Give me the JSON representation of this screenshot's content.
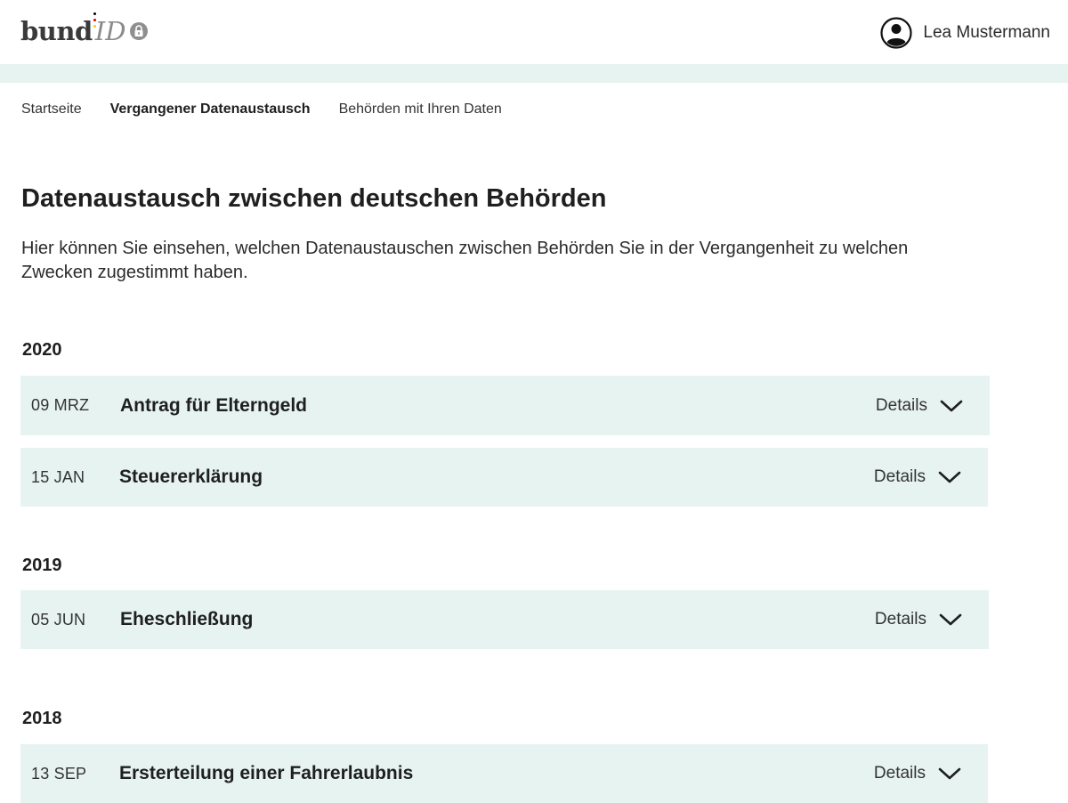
{
  "header": {
    "logo_bund": "bund",
    "logo_id": "ID",
    "user_name": "Lea Mustermann"
  },
  "nav": {
    "items": [
      {
        "label": "Startseite",
        "active": false
      },
      {
        "label": "Vergangener Datenaustausch",
        "active": true
      },
      {
        "label": "Behörden mit Ihren Daten",
        "active": false
      }
    ]
  },
  "main": {
    "title": "Datenaustausch zwischen deutschen Behörden",
    "intro": "Hier können Sie einsehen, welchen Datenaustauschen zwischen Behörden Sie in der Vergangenheit zu welchen Zwecken zugestimmt haben."
  },
  "years": [
    {
      "year": "2020",
      "entries": [
        {
          "date": "09 MRZ",
          "title": "Antrag für Elterngeld",
          "details_label": "Details"
        },
        {
          "date": "15 JAN",
          "title": "Steuererklärung",
          "details_label": "Details"
        }
      ]
    },
    {
      "year": "2019",
      "entries": [
        {
          "date": "05 JUN",
          "title": "Eheschließung",
          "details_label": "Details"
        }
      ]
    },
    {
      "year": "2018",
      "entries": [
        {
          "date": "13 SEP",
          "title": "Ersterteilung einer Fahrerlaubnis",
          "details_label": "Details"
        }
      ]
    }
  ],
  "colors": {
    "band": "#e6f3f1",
    "row_background": "#e6f3f1",
    "logo_dot_black": "#000000",
    "logo_dot_red": "#dd0000",
    "logo_dot_gold": "#ffcc00"
  },
  "icons": {
    "user": "user-circle-icon",
    "lock": "lock-icon",
    "expand": "chevron-down-icon"
  }
}
